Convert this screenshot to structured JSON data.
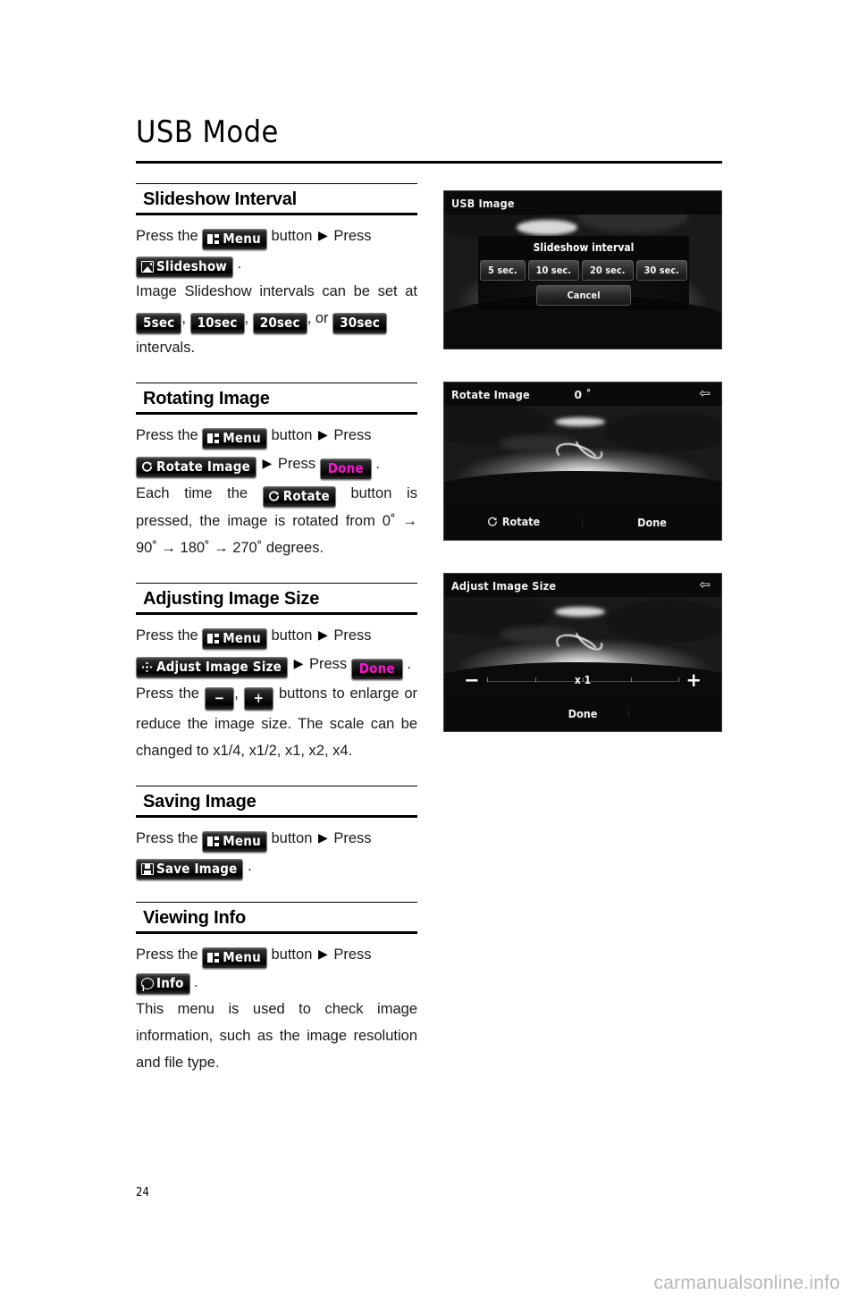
{
  "page": {
    "title": "USB Mode",
    "number": "24",
    "watermark": "carmanualsonline.info"
  },
  "chips": {
    "menu": "Menu",
    "slideshow": "Slideshow",
    "rotate_image": "Rotate Image",
    "rotate": "Rotate",
    "done": "Done",
    "adjust_image_size": "Adjust Image Size",
    "save_image": "Save Image",
    "info": "Info",
    "minus": "−",
    "plus": "+",
    "sec5": "5sec",
    "sec10": "10sec",
    "sec20": "20sec",
    "sec30": "30sec"
  },
  "sections": [
    {
      "id": "slideshow-interval",
      "heading": "Slideshow Interval",
      "line1_a": "Press the",
      "line1_b": "button",
      "line1_c": "Press",
      "line1_d": ".",
      "body_a": "Image Slideshow intervals can be set at",
      "body_sep1": ",",
      "body_sep2": ",",
      "body_or": ", or",
      "body_end": "intervals."
    },
    {
      "id": "rotating-image",
      "heading": "Rotating Image",
      "line1_a": "Press the",
      "line1_b": "button",
      "line1_c": "Press",
      "line2_c": "Press",
      "line2_end": ".",
      "body_a": "Each time the",
      "body_b": "button is pressed, the image is rotated from 0˚ → 90˚ → 180˚ → 270˚ degrees."
    },
    {
      "id": "adjusting-image-size",
      "heading": "Adjusting Image Size",
      "line1_a": "Press the",
      "line1_b": "button",
      "line1_c": "Press",
      "line2_c": "Press",
      "line2_end": ".",
      "body_a": "Press the",
      "body_sep": ",",
      "body_b": "buttons to enlarge or reduce the image size. The scale can be changed to x1/4, x1/2, x1, x2, x4."
    },
    {
      "id": "saving-image",
      "heading": "Saving Image",
      "line1_a": "Press the",
      "line1_b": "button",
      "line1_c": "Press",
      "line1_d": "."
    },
    {
      "id": "viewing-info",
      "heading": "Viewing Info",
      "line1_a": "Press the",
      "line1_b": "button",
      "line1_c": "Press",
      "line1_d": ".",
      "body_a": "This menu is used to check image information, such as the image resolution and file type."
    }
  ],
  "screenshots": [
    {
      "id": "usb-image-slideshow-dialog",
      "header_title": "USB Image",
      "dialog_title": "Slideshow interval",
      "options": [
        "5 sec.",
        "10 sec.",
        "20 sec.",
        "30 sec."
      ],
      "cancel": "Cancel"
    },
    {
      "id": "rotate-image-screen",
      "header_title": "Rotate Image",
      "header_value": "0 ˚",
      "back_icon": "back-arrow-icon",
      "rotate_label": "Rotate",
      "done_label": "Done"
    },
    {
      "id": "adjust-image-size-screen",
      "header_title": "Adjust Image Size",
      "back_icon": "back-arrow-icon",
      "minus_label": "−",
      "scale_label": "x 1",
      "plus_label": "+",
      "done_label": "Done"
    }
  ],
  "colors": {
    "done_accent": "#ff12d4",
    "chip_bg": "#111111",
    "screen_bg": "#070707"
  }
}
